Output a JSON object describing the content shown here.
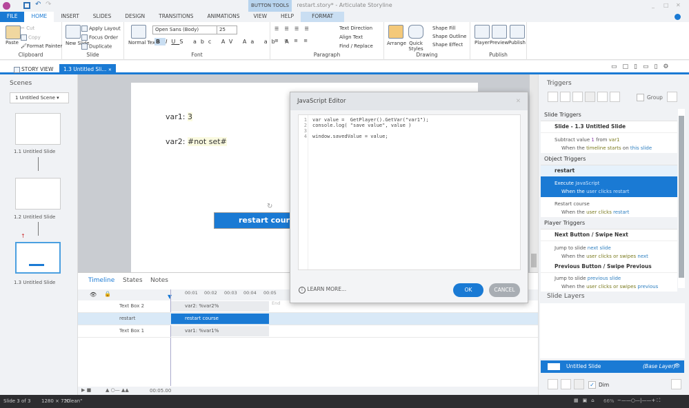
{
  "window": {
    "title": "restart.story* - Articulate Storyline",
    "context_tab": "BUTTON TOOLS"
  },
  "ribbon_tabs": [
    "FILE",
    "HOME",
    "INSERT",
    "SLIDES",
    "DESIGN",
    "TRANSITIONS",
    "ANIMATIONS",
    "VIEW",
    "HELP",
    "FORMAT"
  ],
  "ribbon": {
    "clipboard": {
      "label": "Clipboard",
      "paste": "Paste",
      "cut": "Cut",
      "copy": "Copy",
      "format_painter": "Format Painter"
    },
    "slide": {
      "label": "Slide",
      "new_slide": "New Slide",
      "apply_layout": "Apply Layout",
      "focus_order": "Focus Order",
      "duplicate": "Duplicate"
    },
    "font": {
      "label": "Font",
      "normal_text": "Normal Text",
      "font_name": "Open Sans (Body)",
      "font_size": "25"
    },
    "paragraph": {
      "label": "Paragraph",
      "text_direction": "Text Direction",
      "align_text": "Align Text",
      "find_replace": "Find / Replace"
    },
    "drawing": {
      "label": "Drawing",
      "arrange": "Arrange",
      "quick_styles": "Quick Styles",
      "shape_fill": "Shape Fill",
      "shape_outline": "Shape Outline",
      "shape_effect": "Shape Effect"
    },
    "publish": {
      "label": "Publish",
      "player": "Player",
      "preview": "Preview",
      "publish": "Publish"
    }
  },
  "view_tabs": {
    "story_view": "STORY VIEW",
    "slide_tab": "1.3 Untitled Sli..."
  },
  "scenes": {
    "title": "Scenes",
    "scene_select": "1 Untitled Scene",
    "slides": [
      "1.1 Untitled Slide",
      "1.2 Untitled Slide",
      "1.3 Untitled Slide"
    ]
  },
  "slide": {
    "var1_label": "var1:",
    "var1_value": "3",
    "var2_label": "var2:",
    "var2_value": "#not set#",
    "button_label": "restart cours"
  },
  "timeline": {
    "tabs": [
      "Timeline",
      "States",
      "Notes"
    ],
    "ticks": [
      "00:01",
      "00:02",
      "00:03",
      "00:04",
      "00:05"
    ],
    "end_label": "End",
    "duration": "00:05.00",
    "rows": [
      {
        "name": "Text Box 2",
        "bar": "var2: %var2%"
      },
      {
        "name": "restart",
        "bar": "restart course"
      },
      {
        "name": "Text Box 1",
        "bar": "var1: %var1%"
      }
    ]
  },
  "js_editor": {
    "title": "JavaScript Editor",
    "lines": [
      "var value =  GetPlayer().GetVar(\"var1\");",
      "console.log( \"save value\", value )",
      "",
      "window.savedValue = value;"
    ],
    "learn_more": "LEARN MORE...",
    "ok": "OK",
    "cancel": "CANCEL"
  },
  "triggers": {
    "title": "Triggers",
    "group_label": "Group",
    "slide_triggers": "Slide Triggers",
    "slide_group": "Slide - 1.3 Untitled Slide",
    "t1": {
      "a": "Subtract value",
      "b": "1",
      "c": "from",
      "d": "var1",
      "e": "When the",
      "f": "timeline starts",
      "g": "on",
      "h": "this slide"
    },
    "object_triggers": "Object Triggers",
    "object_group": "restart",
    "t2": {
      "a": "Execute",
      "b": "JavaScript",
      "c": "When the",
      "d": "user clicks",
      "e": "restart"
    },
    "t3": {
      "a": "Restart course",
      "c": "When the",
      "d": "user clicks",
      "e": "restart"
    },
    "player_triggers": "Player Triggers",
    "next_group": "Next Button / Swipe Next",
    "t4": {
      "a": "Jump to slide",
      "b": "next slide",
      "c": "When the",
      "d": "user clicks or swipes",
      "e": "next"
    },
    "prev_group": "Previous Button / Swipe Previous",
    "t5": {
      "a": "Jump to slide",
      "b": "previous slide",
      "c": "When the",
      "d": "user clicks or swipes",
      "e": "previous"
    }
  },
  "layers": {
    "title": "Slide Layers",
    "base_name": "Untitled Slide",
    "base_tag": "(Base Layer)",
    "dim_label": "Dim",
    "dim_checked": true
  },
  "status": {
    "slide": "Slide 3 of 3",
    "size": "1280 × 720",
    "state": "\"Clean\"",
    "zoom": "66%"
  },
  "colors": {
    "accent": "#1a7ad4"
  }
}
